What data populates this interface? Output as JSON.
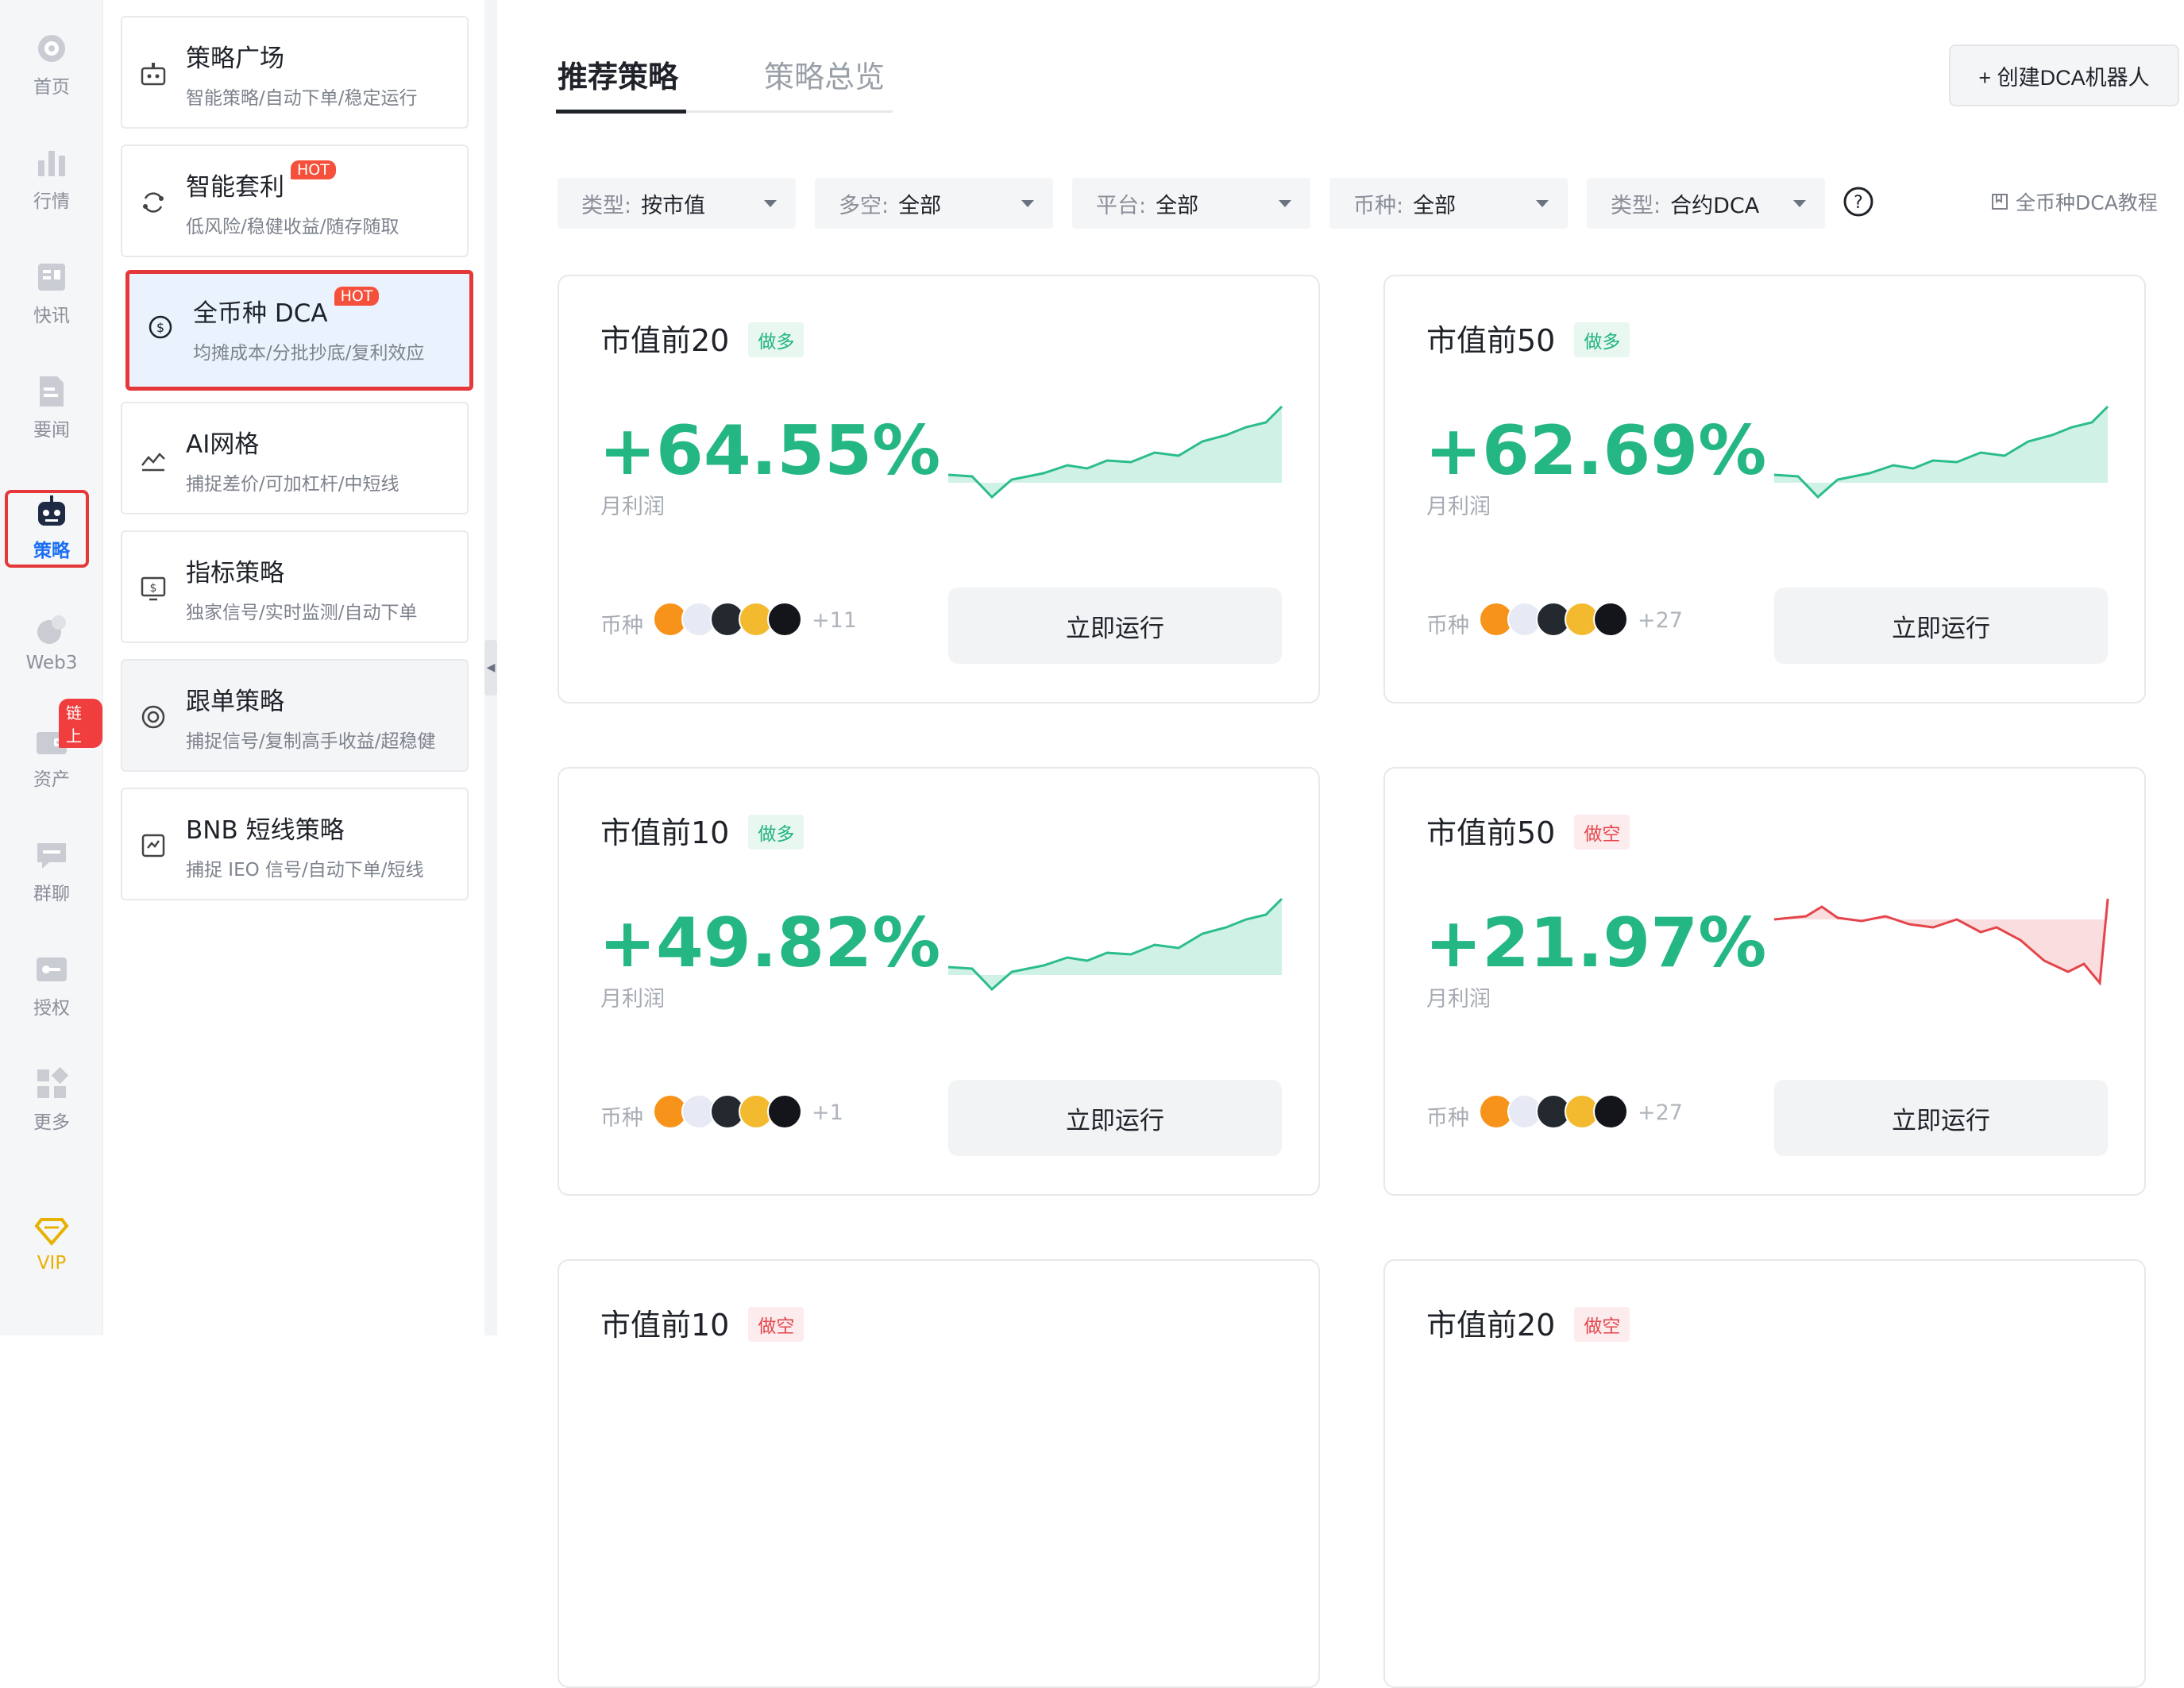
{
  "rail": {
    "items": [
      {
        "label": "首页",
        "icon": "home-icon"
      },
      {
        "label": "行情",
        "icon": "market-icon"
      },
      {
        "label": "快讯",
        "icon": "flash-news-icon"
      },
      {
        "label": "要闻",
        "icon": "news-icon"
      },
      {
        "label": "策略",
        "icon": "robot-icon"
      },
      {
        "label": "Web3",
        "icon": "web3-icon"
      },
      {
        "label": "资产",
        "icon": "wallet-icon"
      },
      {
        "label": "群聊",
        "icon": "chat-icon"
      },
      {
        "label": "授权",
        "icon": "key-icon"
      },
      {
        "label": "更多",
        "icon": "grid-icon"
      },
      {
        "label": "VIP",
        "icon": "vip-diamond-icon"
      }
    ],
    "chain_badge": "链上"
  },
  "menu": {
    "items": [
      {
        "title": "策略广场",
        "desc": "智能策略/自动下单/稳定运行",
        "icon": "bot-icon"
      },
      {
        "title": "智能套利",
        "desc": "低风险/稳健收益/随存随取",
        "icon": "cycle-icon",
        "badge": "HOT"
      },
      {
        "title": "全币种 DCA",
        "desc": "均摊成本/分批抄底/复利效应",
        "icon": "dollar-cycle-icon",
        "badge": "HOT"
      },
      {
        "title": "AI网格",
        "desc": "捕捉差价/可加杠杆/中短线",
        "icon": "grid-chart-icon"
      },
      {
        "title": "指标策略",
        "desc": "独家信号/实时监测/自动下单",
        "icon": "indicator-icon"
      },
      {
        "title": "跟单策略",
        "desc": "捕捉信号/复制高手收益/超稳健",
        "icon": "copy-trade-icon"
      },
      {
        "title": "BNB 短线策略",
        "desc": "捕捉 IEO 信号/自动下单/短线",
        "icon": "bnb-strategy-icon"
      }
    ]
  },
  "main": {
    "tabs": [
      "推荐策略",
      "策略总览"
    ],
    "create_button": "+ 创建DCA机器人",
    "filters": [
      {
        "label": "类型:",
        "value": "按市值"
      },
      {
        "label": "多空:",
        "value": "全部"
      },
      {
        "label": "平台:",
        "value": "全部"
      },
      {
        "label": "币种:",
        "value": "全部"
      },
      {
        "label": "类型:",
        "value": "合约DCA"
      }
    ],
    "tutorial": "全币种DCA教程",
    "coin_label": "币种",
    "run_label": "立即运行",
    "profit_label": "月利润",
    "cards": [
      {
        "title": "市值前20",
        "direction": "做多",
        "dir_type": "long",
        "value": "+64.55%",
        "coins_more": "+11",
        "trend": "up",
        "coins": [
          "btc",
          "eth",
          "xrp",
          "bnb",
          "sol"
        ]
      },
      {
        "title": "市值前50",
        "direction": "做多",
        "dir_type": "long",
        "value": "+62.69%",
        "coins_more": "+27",
        "trend": "up",
        "coins": [
          "btc",
          "eth",
          "xrp",
          "bnb",
          "sol"
        ]
      },
      {
        "title": "市值前10",
        "direction": "做多",
        "dir_type": "long",
        "value": "+49.82%",
        "coins_more": "+1",
        "trend": "up",
        "coins": [
          "btc",
          "eth",
          "xrp",
          "bnb",
          "sol"
        ]
      },
      {
        "title": "市值前50",
        "direction": "做空",
        "dir_type": "short",
        "value": "+21.97%",
        "coins_more": "+27",
        "trend": "down",
        "coins": [
          "btc",
          "eth",
          "xrp",
          "bnb",
          "sol"
        ]
      },
      {
        "title": "市值前10",
        "direction": "做空",
        "dir_type": "short"
      },
      {
        "title": "市值前20",
        "direction": "做空",
        "dir_type": "short"
      }
    ]
  },
  "colors": {
    "accent_blue": "#1b6ef3",
    "profit_green": "#25b783",
    "loss_red": "#e4454b",
    "highlight_red": "#e5383b",
    "hot_orange": "#f5503c"
  }
}
